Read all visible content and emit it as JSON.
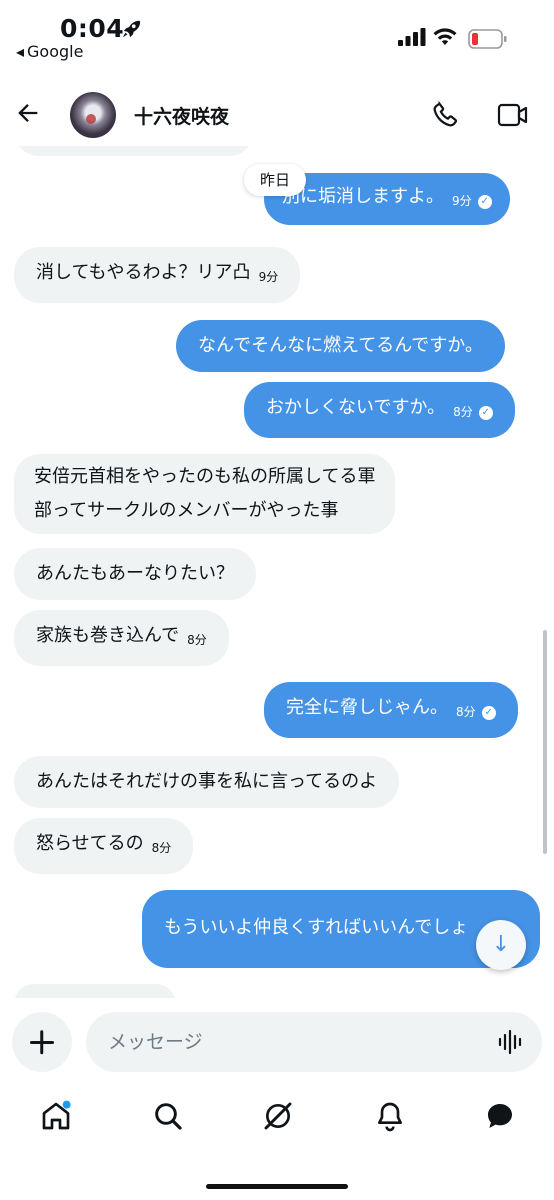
{
  "status_bar": {
    "time": "0:04",
    "back_app_label": "Google"
  },
  "header": {
    "contact_name": "十六夜咲夜"
  },
  "chat": {
    "date_chip": "昨日",
    "messages": [
      {
        "dir": "out",
        "text": "別に垢消しますよ。",
        "time": "9分",
        "read": true
      },
      {
        "dir": "in",
        "text": "消してもやるわよ？リア凸",
        "time": "9分"
      },
      {
        "dir": "out",
        "text": "なんでそんなに燃えてるんですか。",
        "time": ""
      },
      {
        "dir": "out",
        "text": "おかしくないですか。",
        "time": "8分",
        "read": true
      },
      {
        "dir": "in",
        "text_line1": "安倍元首相をやったのも私の所属してる軍",
        "text_line2": "部ってサークルのメンバーがやった事",
        "time": ""
      },
      {
        "dir": "in",
        "text": "あんたもあーなりたい？",
        "time": ""
      },
      {
        "dir": "in",
        "text": "家族も巻き込んで",
        "time": "8分"
      },
      {
        "dir": "out",
        "text": "完全に脅しじゃん。",
        "time": "8分",
        "read": true
      },
      {
        "dir": "in",
        "text": "あんたはそれだけの事を私に言ってるのよ",
        "time": ""
      },
      {
        "dir": "in",
        "text": "怒らせてるの",
        "time": "8分"
      },
      {
        "dir": "out",
        "text": "もういいよ仲良くすればいいんでしょ",
        "time": ""
      }
    ]
  },
  "composer": {
    "placeholder": "メッセージ"
  },
  "colors": {
    "outgoing_bubble": "#4593e6",
    "incoming_bubble": "#eff3f4",
    "text": "#0f1419"
  },
  "icons": {
    "status": [
      "rocket-icon",
      "signal-icon",
      "wifi-icon",
      "battery-icon"
    ],
    "header": [
      "back-arrow-icon",
      "phone-icon",
      "video-icon"
    ],
    "composer": [
      "plus-icon",
      "voice-icon"
    ],
    "nav": [
      "home-icon",
      "search-icon",
      "grok-icon",
      "notifications-icon",
      "messages-icon"
    ]
  }
}
